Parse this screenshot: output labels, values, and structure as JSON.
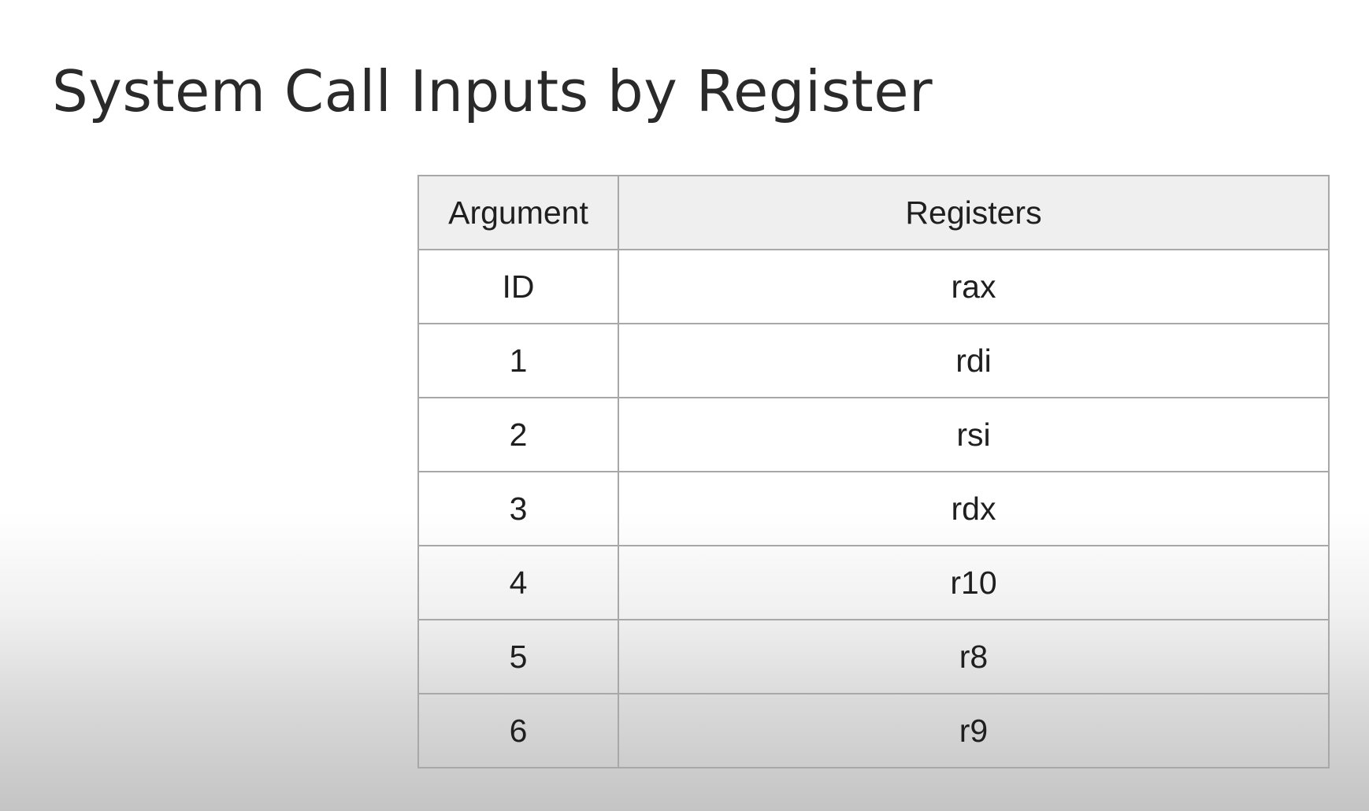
{
  "slide": {
    "title": "System Call Inputs by Register"
  },
  "table": {
    "headers": [
      "Argument",
      "Registers"
    ],
    "rows": [
      [
        "ID",
        "rax"
      ],
      [
        "1",
        "rdi"
      ],
      [
        "2",
        "rsi"
      ],
      [
        "3",
        "rdx"
      ],
      [
        "4",
        "r10"
      ],
      [
        "5",
        "r8"
      ],
      [
        "6",
        "r9"
      ]
    ]
  },
  "colors": {
    "header_background": "#efefef",
    "border": "#a8a8a8",
    "text": "#262626"
  }
}
